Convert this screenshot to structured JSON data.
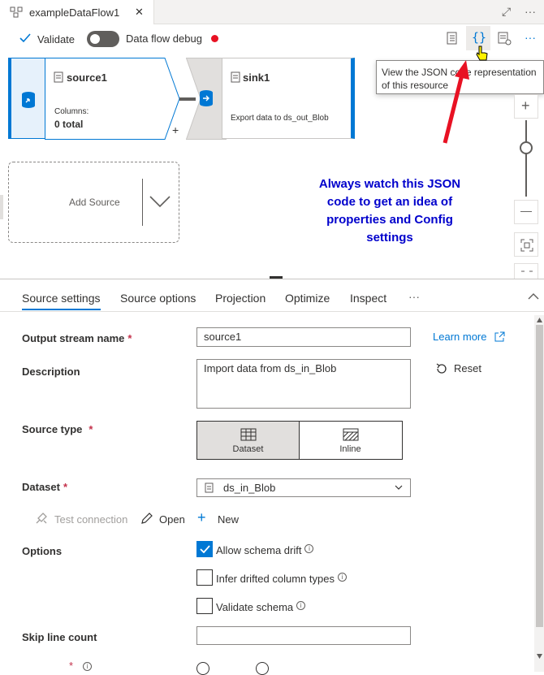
{
  "tab": {
    "title": "exampleDataFlow1",
    "close": "✕",
    "expand": "⤢",
    "more": "···"
  },
  "toolbar": {
    "validate": "Validate",
    "debug_label": "Data flow debug",
    "more": "···"
  },
  "nodes": {
    "source": {
      "title": "source1",
      "columns_label": "Columns:",
      "columns_value": "0 total"
    },
    "sink": {
      "title": "sink1",
      "desc": "Export data to ds_out_Blob"
    },
    "add_source": "Add Source"
  },
  "tooltip": "View the JSON code representation of this resource",
  "annotation": "Always watch this JSON code to get an idea of properties and Config settings",
  "zoom": {
    "plus": "+",
    "minus": "—"
  },
  "panel_tabs": [
    "Source settings",
    "Source options",
    "Projection",
    "Optimize",
    "Inspect",
    "···"
  ],
  "form": {
    "output_stream_name": {
      "label": "Output stream name",
      "value": "source1"
    },
    "description": {
      "label": "Description",
      "value": "Import data from ds_in_Blob"
    },
    "learn_more": "Learn more",
    "reset": "Reset",
    "source_type": {
      "label": "Source type",
      "dataset": "Dataset",
      "inline": "Inline"
    },
    "dataset": {
      "label": "Dataset",
      "value": "ds_in_Blob"
    },
    "actions": {
      "test": "Test connection",
      "open": "Open",
      "new": "New"
    },
    "options": {
      "label": "Options",
      "allow": "Allow schema drift",
      "infer": "Infer drifted column types",
      "validate": "Validate schema"
    },
    "skip": {
      "label": "Skip line count",
      "value": ""
    }
  },
  "colors": {
    "accent": "#0078d4",
    "annotation": "#0000cc",
    "arrow": "#e81123",
    "debug_dot": "#e81123"
  }
}
